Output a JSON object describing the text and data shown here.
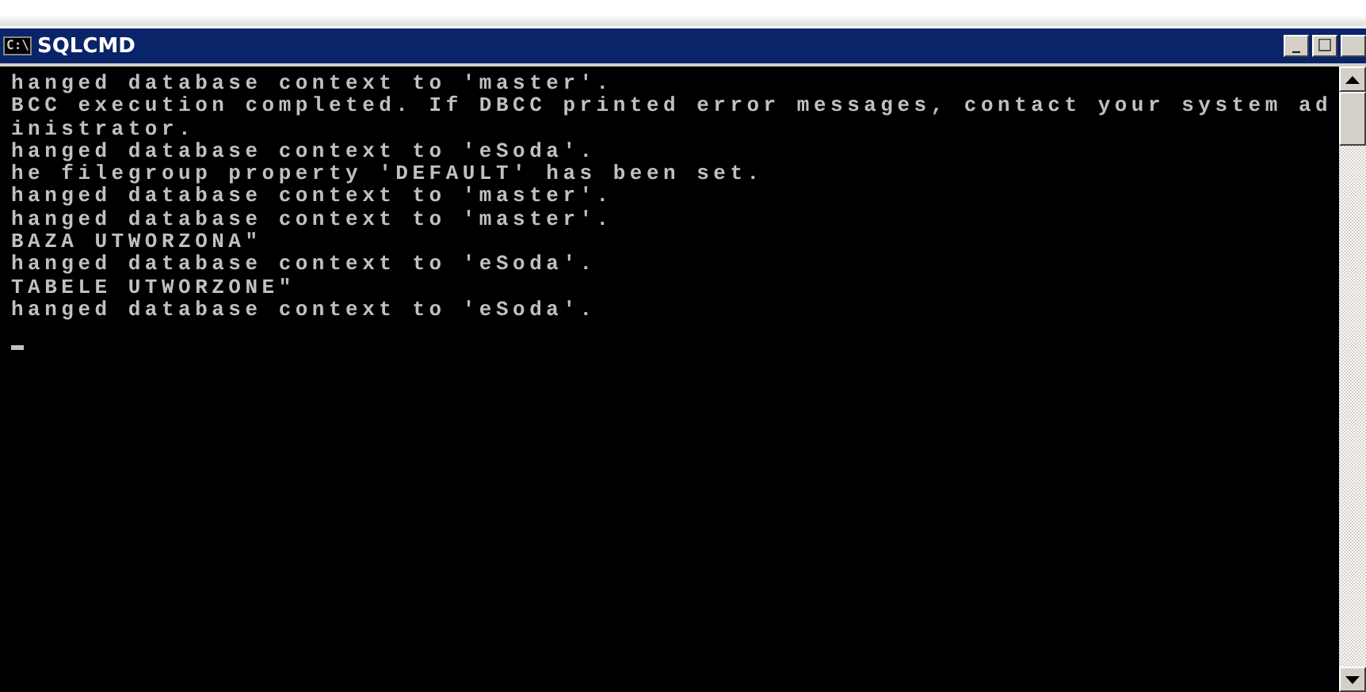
{
  "window": {
    "title": "SQLCMD",
    "icon_text": "C:\\",
    "buttons": [
      "_",
      "□"
    ]
  },
  "console": {
    "lines": [
      "hanged database context to 'master'.",
      "BCC execution completed. If DBCC printed error messages, contact your system ad",
      "inistrator.",
      "hanged database context to 'eSoda'.",
      "he filegroup property 'DEFAULT' has been set.",
      "hanged database context to 'master'.",
      "hanged database context to 'master'.",
      "BAZA UTWORZONA\"",
      "hanged database context to 'eSoda'.",
      "TABELE UTWORZONE\"",
      "hanged database context to 'eSoda'."
    ]
  }
}
